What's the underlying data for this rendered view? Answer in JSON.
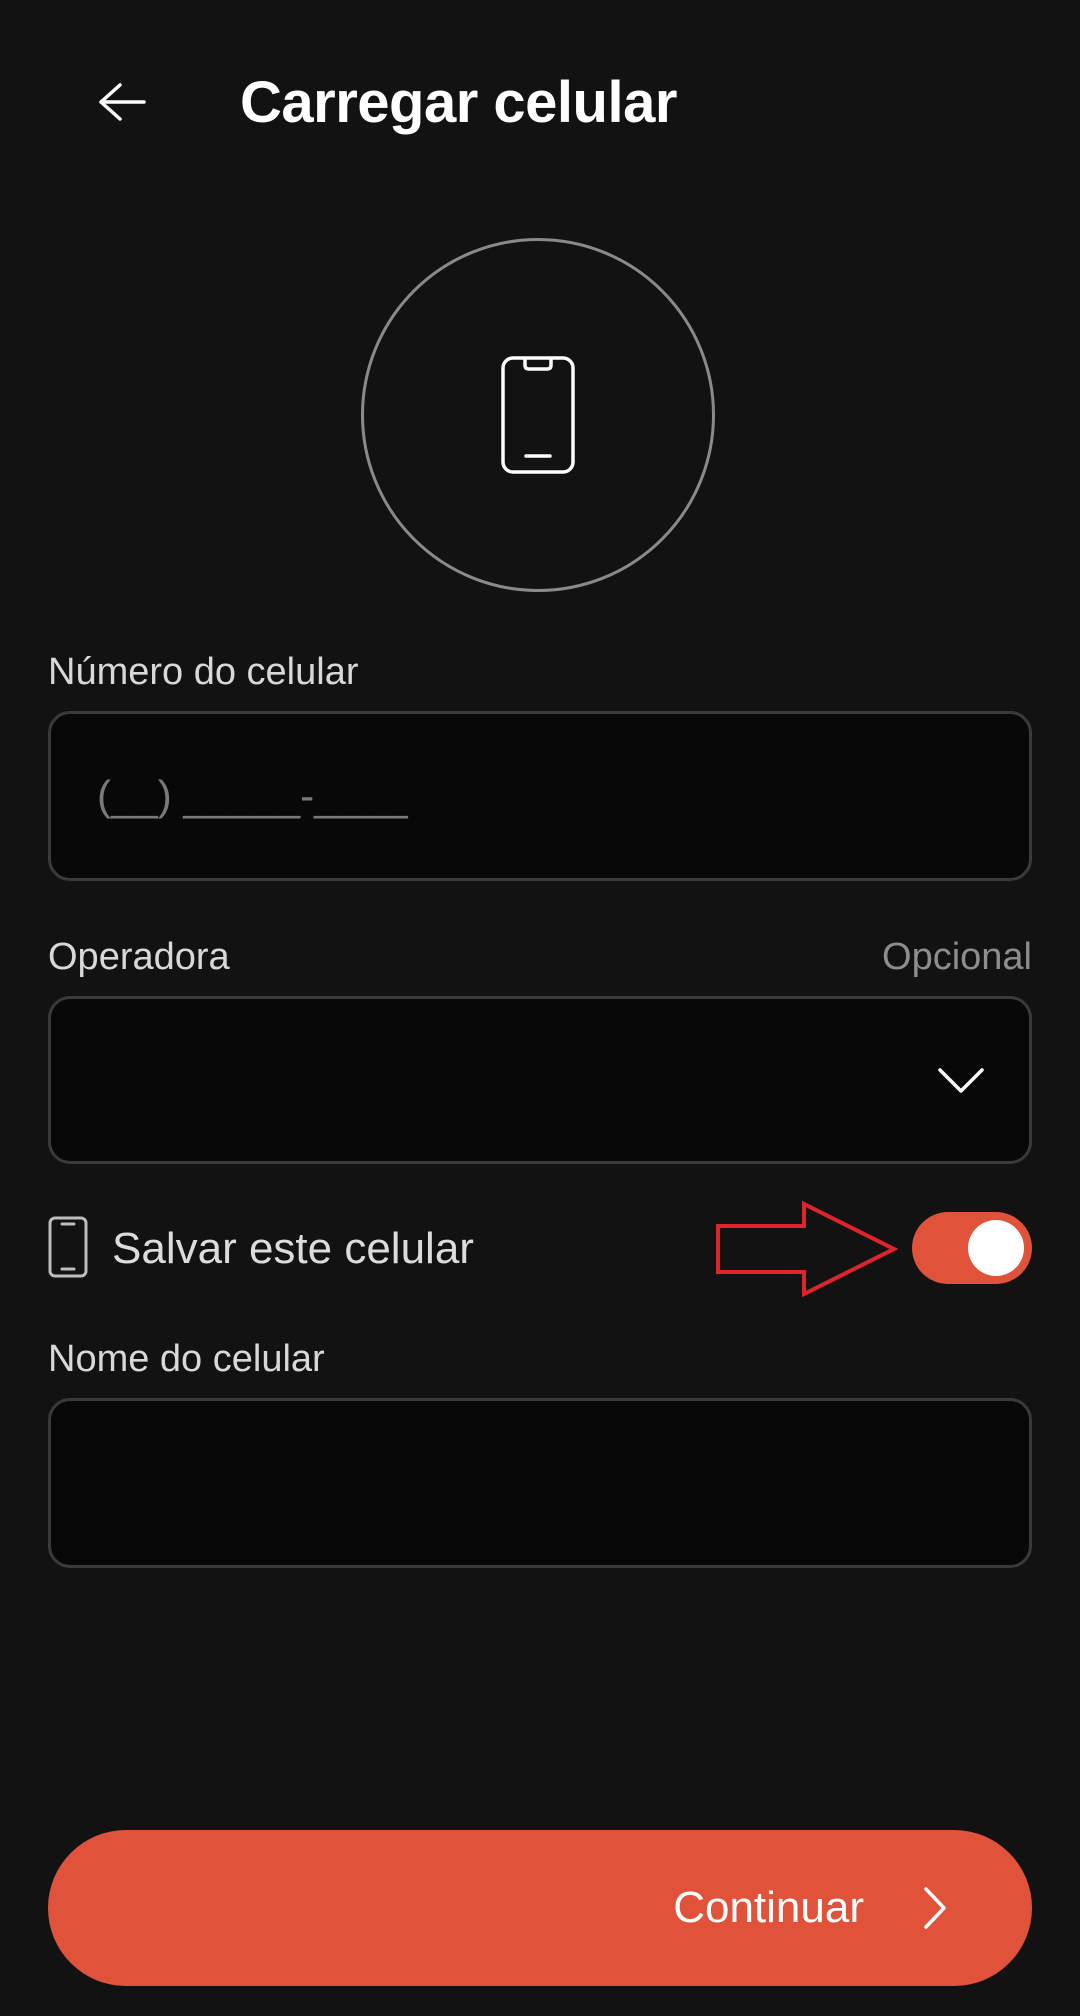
{
  "header": {
    "title": "Carregar celular",
    "back_icon": "arrow-left-icon"
  },
  "hero": {
    "icon": "smartphone-icon"
  },
  "phone_field": {
    "label": "Número do celular",
    "placeholder": "(__) _____-____",
    "value": ""
  },
  "carrier_field": {
    "label": "Operadora",
    "optional_label": "Opcional",
    "selected_value": "",
    "chevron_icon": "chevron-down-icon"
  },
  "save_phone": {
    "label": "Salvar este celular",
    "icon": "smartphone-icon",
    "enabled": true
  },
  "nickname_field": {
    "label": "Nome do celular",
    "value": ""
  },
  "continue_button": {
    "label": "Continuar",
    "icon": "chevron-right-icon"
  },
  "colors": {
    "background": "#121212",
    "accent": "#e0533a",
    "annotation": "#e0242b"
  }
}
